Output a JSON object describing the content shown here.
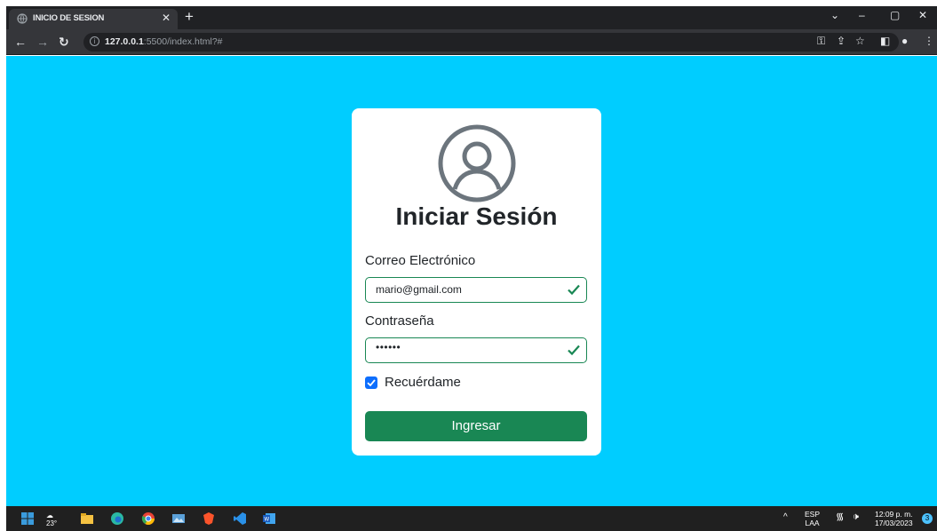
{
  "browser": {
    "tab_title": "INICIO DE SESION",
    "url_host": "127.0.0.1",
    "url_path": ":5500/index.html?#"
  },
  "login": {
    "heading": "Iniciar Sesión",
    "email_label": "Correo Electrónico",
    "email_value": "mario@gmail.com",
    "password_label": "Contraseña",
    "password_value": "••••••",
    "remember_label": "Recuérdame",
    "remember_checked": true,
    "submit_label": "Ingresar"
  },
  "colors": {
    "page_background": "#00cdff",
    "success_green": "#198754",
    "checkbox_blue": "#0d6efd",
    "avatar_gray": "#6c757d"
  },
  "taskbar": {
    "weather_temp": "23°",
    "language": "ESP",
    "language_sub": "LAA",
    "time": "12:09 p. m.",
    "date": "17/03/2023",
    "notification_count": "3",
    "icons": [
      "windows-start-icon",
      "weather-icon",
      "file-explorer-icon",
      "edge-icon",
      "chrome-icon",
      "photos-icon",
      "brave-icon",
      "vscode-icon",
      "word-icon"
    ]
  }
}
